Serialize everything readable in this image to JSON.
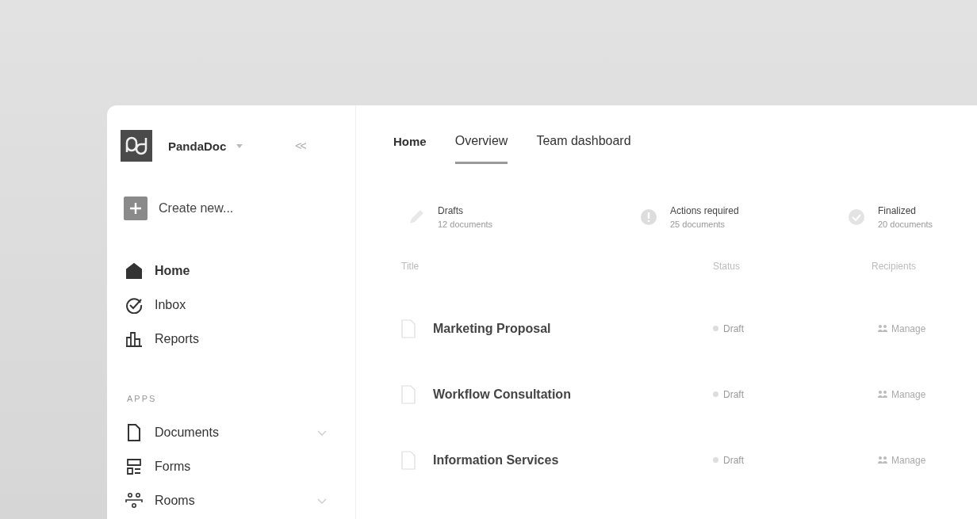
{
  "sidebar": {
    "brand": "PandaDoc",
    "collapse": "<<",
    "create": "Create new...",
    "nav": [
      {
        "label": "Home",
        "selected": true
      },
      {
        "label": "Inbox",
        "selected": false
      },
      {
        "label": "Reports",
        "selected": false
      }
    ],
    "section": "APPS",
    "apps": [
      {
        "label": "Documents",
        "expanded": false,
        "expandable": true
      },
      {
        "label": "Forms",
        "expandable": false
      },
      {
        "label": "Rooms",
        "expanded": false,
        "expandable": true
      }
    ]
  },
  "page_title": "Home",
  "tabs": [
    {
      "label": "Overview",
      "selected": true
    },
    {
      "label": "Team dashboard",
      "selected": false
    }
  ],
  "stats": [
    {
      "label": "Drafts",
      "count": "12 documents"
    },
    {
      "label": "Actions required",
      "count": "25 documents"
    },
    {
      "label": "Finalized",
      "count": "20 documents"
    }
  ],
  "table": {
    "columns": [
      "Title",
      "Status",
      "Recipients"
    ],
    "rows": [
      {
        "title": "Marketing Proposal",
        "status": "Draft",
        "recipients": "Manage"
      },
      {
        "title": "Workflow Consultation",
        "status": "Draft",
        "recipients": "Manage"
      },
      {
        "title": "Information Services",
        "status": "Draft",
        "recipients": "Manage"
      }
    ]
  }
}
